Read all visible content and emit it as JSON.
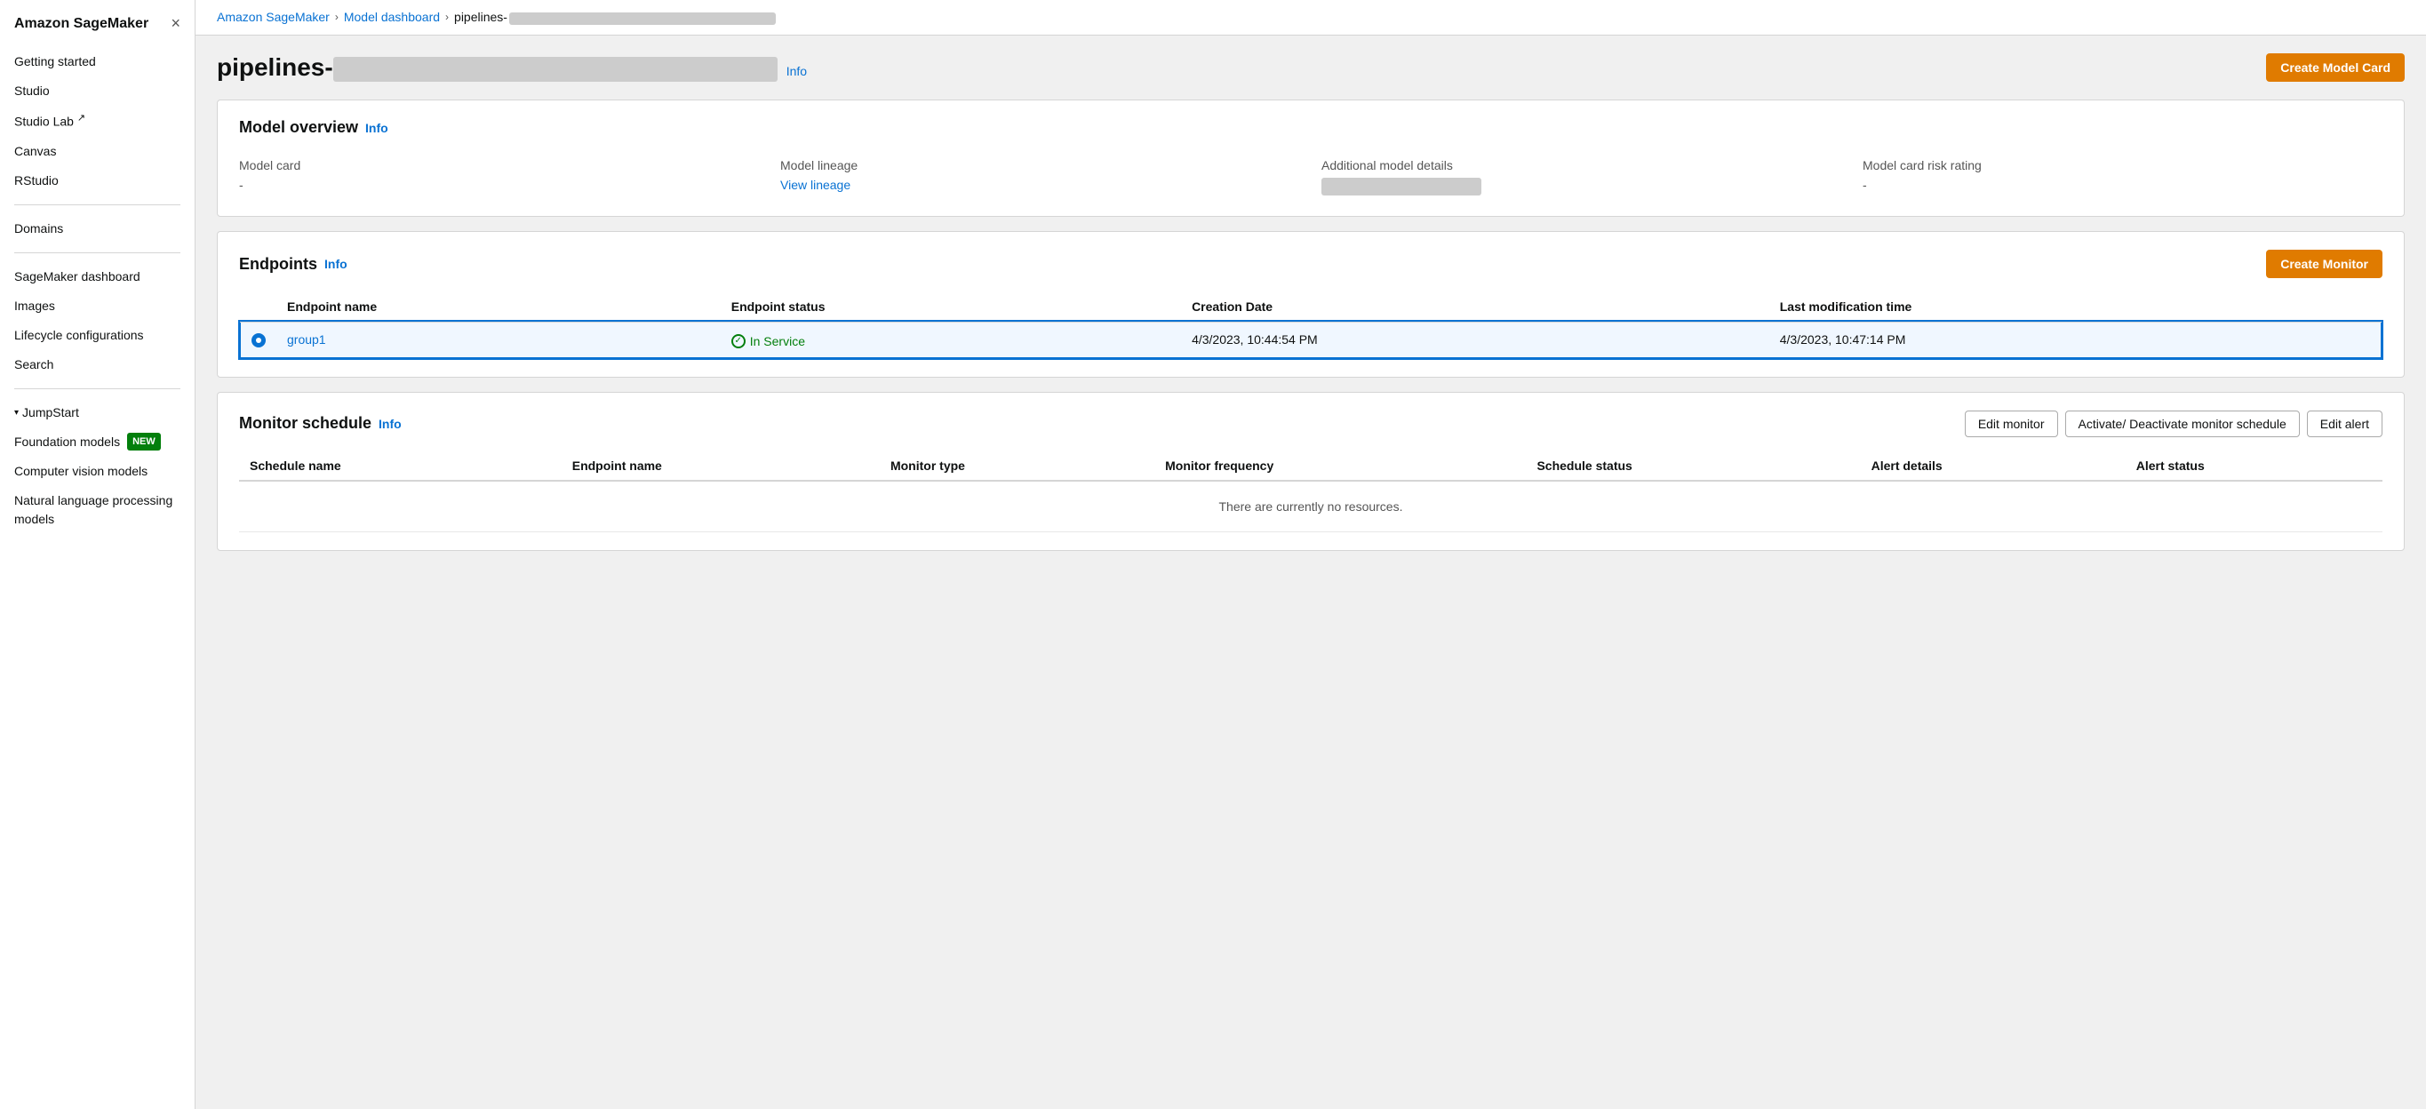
{
  "sidebar": {
    "title": "Amazon SageMaker",
    "close_label": "×",
    "nav_items": [
      {
        "id": "getting-started",
        "label": "Getting started"
      },
      {
        "id": "studio",
        "label": "Studio"
      },
      {
        "id": "studio-lab",
        "label": "Studio Lab",
        "external": true
      },
      {
        "id": "canvas",
        "label": "Canvas"
      },
      {
        "id": "rstudio",
        "label": "RStudio"
      },
      {
        "id": "domains",
        "label": "Domains"
      },
      {
        "id": "sagemaker-dashboard",
        "label": "SageMaker dashboard"
      },
      {
        "id": "images",
        "label": "Images"
      },
      {
        "id": "lifecycle-configurations",
        "label": "Lifecycle configurations"
      },
      {
        "id": "search",
        "label": "Search"
      },
      {
        "id": "jumpstart",
        "label": "JumpStart",
        "arrow": true
      },
      {
        "id": "foundation-models",
        "label": "Foundation models",
        "badge": "NEW"
      },
      {
        "id": "computer-vision-models",
        "label": "Computer vision models"
      },
      {
        "id": "nlp-models",
        "label": "Natural language processing models"
      }
    ]
  },
  "breadcrumb": {
    "items": [
      {
        "label": "Amazon SageMaker",
        "link": true
      },
      {
        "label": "Model dashboard",
        "link": true
      },
      {
        "label": "pipelines-redacted",
        "link": false,
        "redacted": true
      }
    ]
  },
  "page": {
    "title": "pipelines-",
    "info_label": "Info",
    "create_model_card_label": "Create Model Card"
  },
  "model_overview": {
    "title": "Model overview",
    "info_label": "Info",
    "columns": [
      {
        "label": "Model card",
        "value": "-",
        "is_dash": true
      },
      {
        "label": "Model lineage",
        "value": "View lineage",
        "is_link": true
      },
      {
        "label": "Additional model details",
        "value": "",
        "is_redacted": true
      },
      {
        "label": "Model card risk rating",
        "value": "-",
        "is_dash": true
      }
    ]
  },
  "endpoints": {
    "title": "Endpoints",
    "info_label": "Info",
    "create_monitor_label": "Create Monitor",
    "columns": [
      {
        "label": "Endpoint name"
      },
      {
        "label": "Endpoint status"
      },
      {
        "label": "Creation Date"
      },
      {
        "label": "Last modification time"
      }
    ],
    "rows": [
      {
        "selected": true,
        "name": "group1",
        "status": "In Service",
        "creation_date": "4/3/2023, 10:44:54 PM",
        "last_modified": "4/3/2023, 10:47:14 PM"
      }
    ]
  },
  "monitor_schedule": {
    "title": "Monitor schedule",
    "info_label": "Info",
    "edit_monitor_label": "Edit monitor",
    "activate_deactivate_label": "Activate/ Deactivate monitor schedule",
    "edit_alert_label": "Edit alert",
    "columns": [
      {
        "label": "Schedule name"
      },
      {
        "label": "Endpoint name"
      },
      {
        "label": "Monitor type"
      },
      {
        "label": "Monitor frequency"
      },
      {
        "label": "Schedule status"
      },
      {
        "label": "Alert details"
      },
      {
        "label": "Alert status"
      }
    ],
    "empty_message": "There are currently no resources."
  }
}
